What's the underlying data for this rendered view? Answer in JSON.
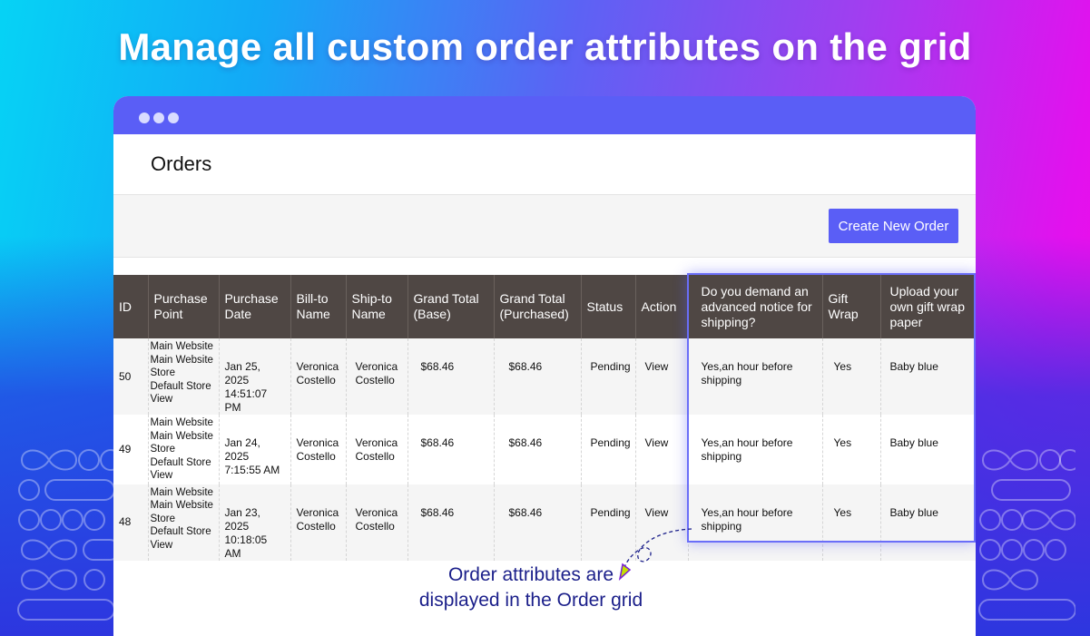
{
  "headline": "Manage all custom order attributes on the grid",
  "page": {
    "title": "Orders"
  },
  "toolbar": {
    "create_label": "Create New Order"
  },
  "grid": {
    "columns": [
      "ID",
      "Purchase Point",
      "Purchase Date",
      "Bill-to Name",
      "Ship-to Name",
      "Grand Total (Base)",
      "Grand Total (Purchased)",
      "Status",
      "Action",
      "Do you demand an advanced notice for shipping?",
      "Gift Wrap",
      "Upload your own gift wrap paper"
    ],
    "rows": [
      {
        "id": "50",
        "purchase_point": [
          "Main Website",
          "Main Website",
          "Store",
          "Default Store",
          "View"
        ],
        "purchase_date": [
          "Jan 25, 2025",
          "14:51:07 PM"
        ],
        "bill_to": [
          "Veronica",
          "Costello"
        ],
        "ship_to": [
          "Veronica",
          "Costello"
        ],
        "grand_total_base": "$68.46",
        "grand_total_purchased": "$68.46",
        "status": "Pending",
        "action": "View",
        "advanced_notice": [
          "Yes,an hour before",
          "shipping"
        ],
        "gift_wrap": "Yes",
        "gift_wrap_paper": "Baby blue"
      },
      {
        "id": "49",
        "purchase_point": [
          "Main Website",
          "Main Website",
          "Store",
          "Default Store",
          "View"
        ],
        "purchase_date": [
          "Jan 24, 2025",
          "7:15:55 AM"
        ],
        "bill_to": [
          "Veronica",
          "Costello"
        ],
        "ship_to": [
          "Veronica",
          "Costello"
        ],
        "grand_total_base": "$68.46",
        "grand_total_purchased": "$68.46",
        "status": "Pending",
        "action": "View",
        "advanced_notice": [
          "Yes,an hour before",
          "shipping"
        ],
        "gift_wrap": "Yes",
        "gift_wrap_paper": "Baby blue"
      },
      {
        "id": "48",
        "purchase_point": [
          "Main Website",
          "Main Website",
          "Store",
          "Default Store",
          "View"
        ],
        "purchase_date": [
          "Jan 23, 2025",
          "10:18:05 AM"
        ],
        "bill_to": [
          "Veronica",
          "Costello"
        ],
        "ship_to": [
          "Veronica",
          "Costello"
        ],
        "grand_total_base": "$68.46",
        "grand_total_purchased": "$68.46",
        "status": "Pending",
        "action": "View",
        "advanced_notice": [
          "Yes,an hour before",
          "shipping"
        ],
        "gift_wrap": "Yes",
        "gift_wrap_paper": "Baby blue"
      }
    ]
  },
  "annotation": {
    "line1": "Order attributes are",
    "line2": "displayed in the Order grid"
  },
  "colors": {
    "accent": "#5a5ef6",
    "header_bg": "#4f4744",
    "annotation_text": "#1b1f8a"
  }
}
